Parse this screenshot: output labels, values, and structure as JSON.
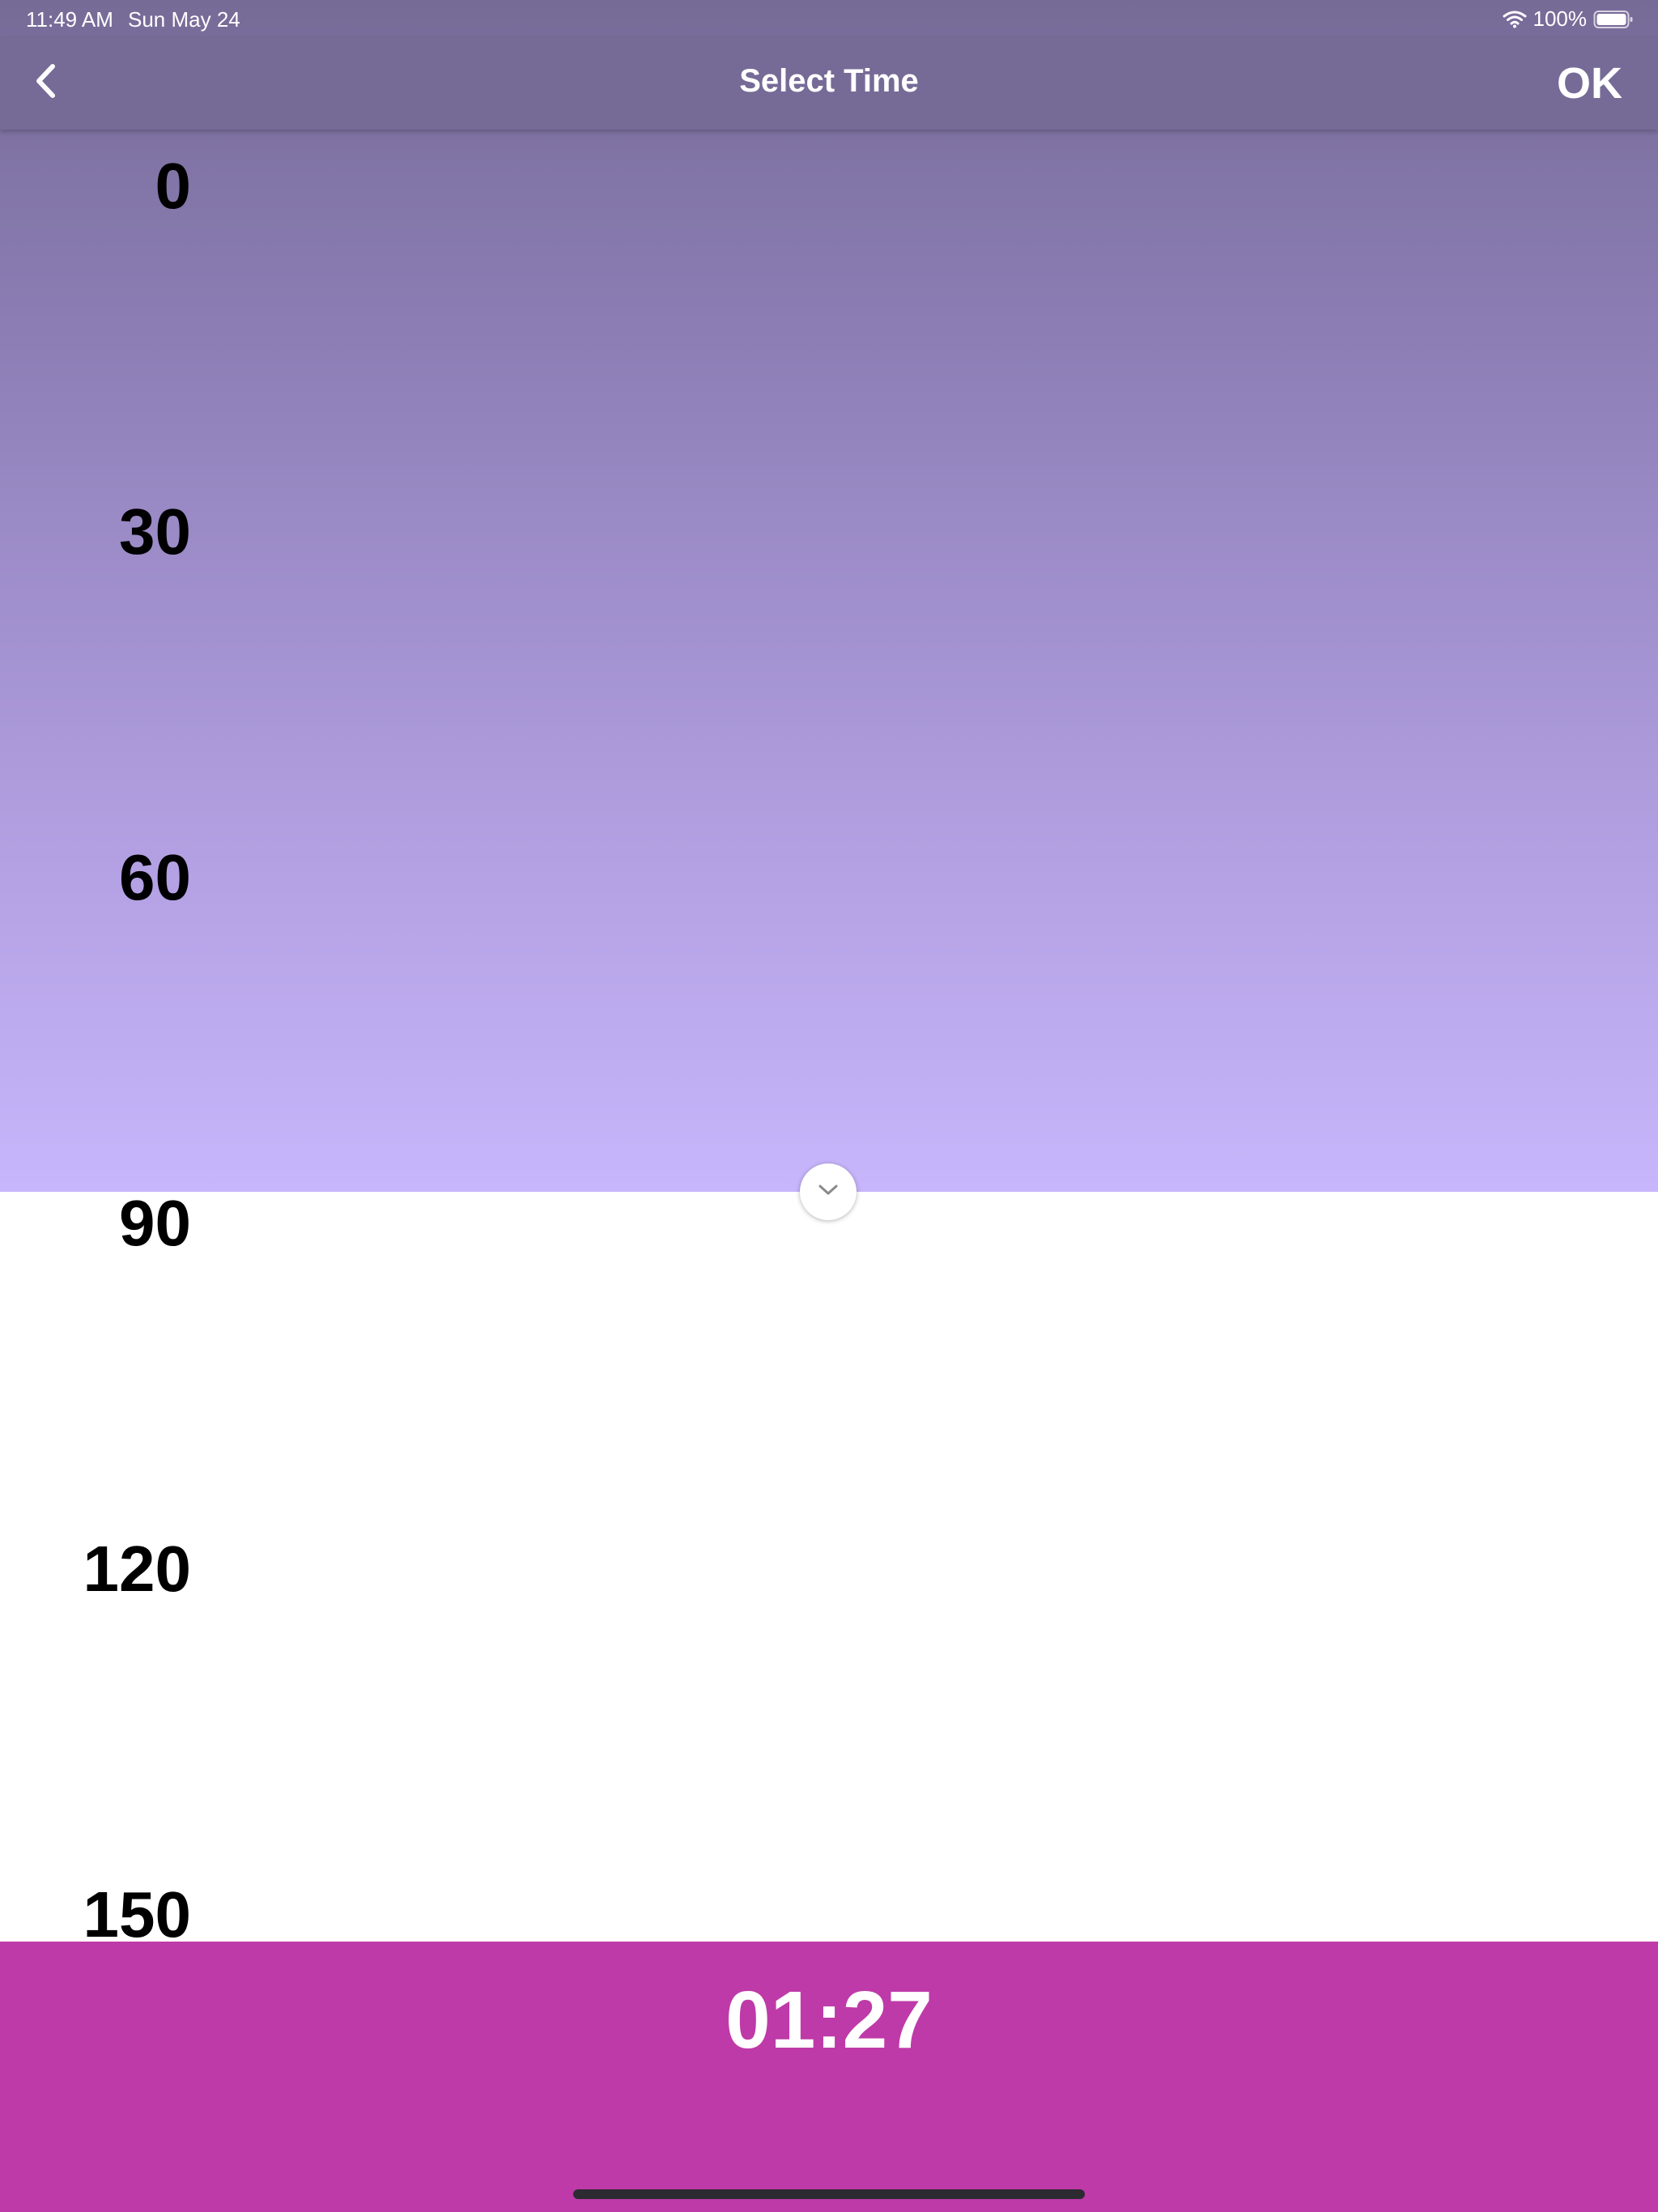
{
  "status_bar": {
    "time": "11:49 AM",
    "date": "Sun May 24",
    "battery": "100%"
  },
  "nav": {
    "title": "Select Time",
    "ok_label": "OK",
    "back_icon": "chevron-left-icon"
  },
  "scale": {
    "tick_labels": [
      "0",
      "30",
      "60",
      "90",
      "120",
      "150"
    ]
  },
  "selection": {
    "fill_level_fraction": 0.55
  },
  "handle": {
    "icon": "chevron-down-icon"
  },
  "footer": {
    "time_value": "01:27"
  },
  "colors": {
    "nav_background": "#766b97",
    "gradient_top": "#766b97",
    "gradient_bottom": "#c8b6fc",
    "footer_background": "#be3aa8",
    "text_primary": "#000000",
    "text_on_accent": "#ffffff"
  }
}
